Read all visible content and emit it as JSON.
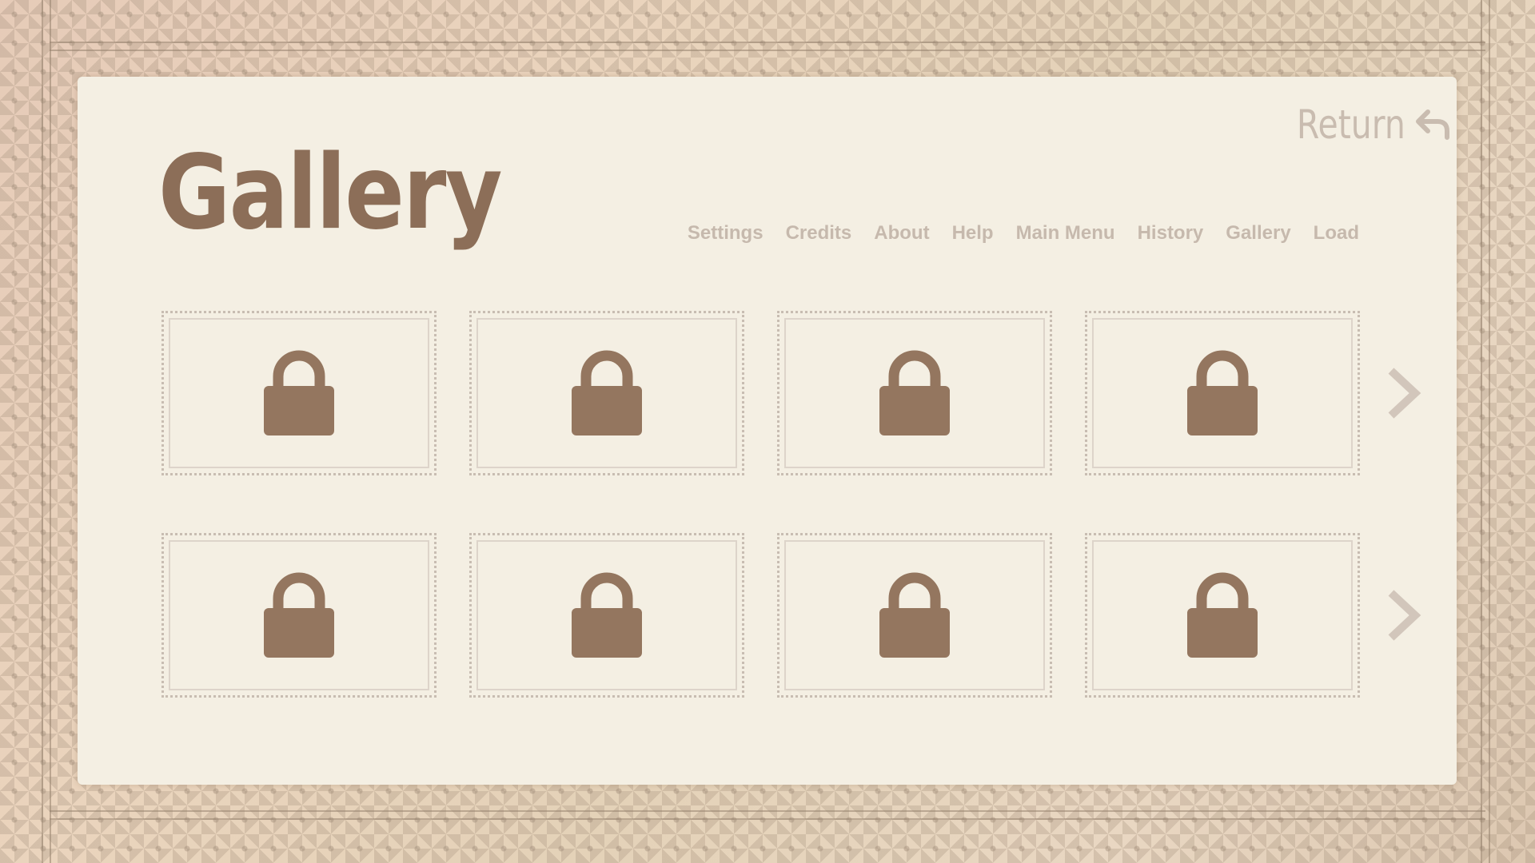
{
  "screen": {
    "title": "Gallery"
  },
  "return_button": {
    "label": "Return",
    "icon": "return-arrow-icon"
  },
  "nav": {
    "items": [
      {
        "label": "Settings"
      },
      {
        "label": "Credits"
      },
      {
        "label": "About"
      },
      {
        "label": "Help"
      },
      {
        "label": "Main Menu"
      },
      {
        "label": "History"
      },
      {
        "label": "Gallery"
      },
      {
        "label": "Load"
      }
    ]
  },
  "gallery": {
    "rows": 2,
    "columns": 4,
    "slots": [
      {
        "state": "locked",
        "icon": "lock-icon"
      },
      {
        "state": "locked",
        "icon": "lock-icon"
      },
      {
        "state": "locked",
        "icon": "lock-icon"
      },
      {
        "state": "locked",
        "icon": "lock-icon"
      },
      {
        "state": "locked",
        "icon": "lock-icon"
      },
      {
        "state": "locked",
        "icon": "lock-icon"
      },
      {
        "state": "locked",
        "icon": "lock-icon"
      },
      {
        "state": "locked",
        "icon": "lock-icon"
      }
    ],
    "next_icon": "chevron-right-icon"
  },
  "colors": {
    "title": "#8c6e58",
    "lock": "#94765f",
    "nav_text": "#c6b9ad",
    "panel": "#f4efe3"
  }
}
